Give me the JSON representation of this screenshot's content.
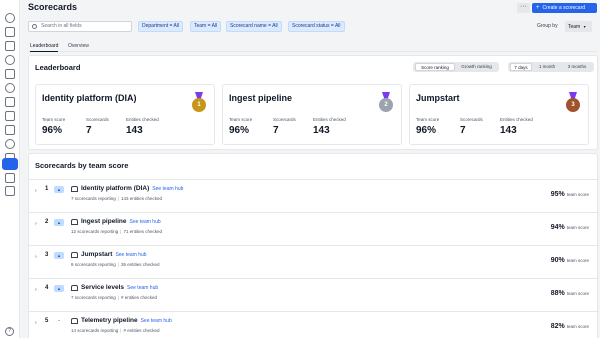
{
  "header": {
    "title": "Scorecards",
    "more_label": "···",
    "create_label": "Create a scorecard"
  },
  "filters": {
    "search_placeholder": "Search in all fields",
    "chips": [
      "Department = All",
      "Team = All",
      "Scorecard name = All",
      "Scorecard status = All"
    ],
    "group_by_label": "Group by",
    "group_by_value": "Team"
  },
  "tabs": [
    "Leaderboard",
    "Overview"
  ],
  "leaderboard": {
    "title": "Leaderboard",
    "ranking_modes": [
      "Score ranking",
      "Growth ranking"
    ],
    "periods": [
      "7 days",
      "1 month",
      "3 months"
    ],
    "cards": [
      {
        "name": "Identity platform (DIA)",
        "medal_rank": "1",
        "medal_color": "#c8941a",
        "team_score_label": "Team score",
        "team_score": "96%",
        "scorecards_label": "Scorecards",
        "scorecards": "7",
        "entities_label": "Entities checked",
        "entities": "143"
      },
      {
        "name": "Ingest pipeline",
        "medal_rank": "2",
        "medal_color": "#9ca3af",
        "team_score_label": "Team score",
        "team_score": "96%",
        "scorecards_label": "Scorecards",
        "scorecards": "7",
        "entities_label": "Entities checked",
        "entities": "143"
      },
      {
        "name": "Jumpstart",
        "medal_rank": "3",
        "medal_color": "#a0522d",
        "team_score_label": "Team score",
        "team_score": "96%",
        "scorecards_label": "Scorecards",
        "scorecards": "7",
        "entities_label": "Entities checked",
        "entities": "143"
      }
    ]
  },
  "team_scores": {
    "title": "Scorecards by team score",
    "hub_label": "See team hub",
    "score_unit": "team score",
    "rows": [
      {
        "rank": "1",
        "trend": "▲",
        "name": "Identity platform (DIA)",
        "reporting": "7 scorecards reporting",
        "entities": "143 entities checked",
        "score": "95%"
      },
      {
        "rank": "2",
        "trend": "▲",
        "name": "Ingest pipeline",
        "reporting": "12 scorecards reporting",
        "entities": "71 entities checked",
        "score": "94%"
      },
      {
        "rank": "3",
        "trend": "▲",
        "name": "Jumpstart",
        "reporting": "8 scorecards reporting",
        "entities": "36 entities checked",
        "score": "90%"
      },
      {
        "rank": "4",
        "trend": "▲",
        "name": "Service levels",
        "reporting": "7 scorecards reporting",
        "entities": "# entities checked",
        "score": "88%"
      },
      {
        "rank": "5",
        "trend": "-",
        "name": "Telemetry pipeline",
        "reporting": "14 scorecards reporting",
        "entities": "# entities checked",
        "score": "82%"
      }
    ]
  },
  "help_label": "?"
}
